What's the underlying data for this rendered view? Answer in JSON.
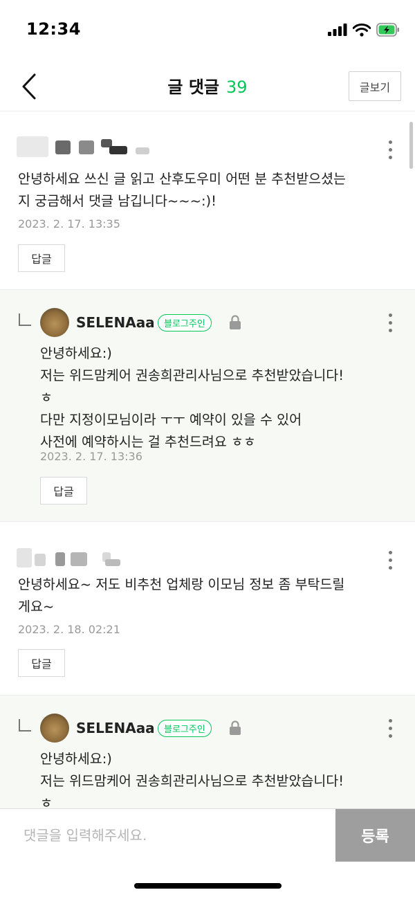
{
  "status_bar": {
    "time": "12:34"
  },
  "header": {
    "title": "글 댓글",
    "count": "39",
    "view_post_label": "글보기"
  },
  "comments": [
    {
      "text_lines": [
        "안녕하세요 쓰신 글 읽고 산후도우미 어떤 분 추천받으셨는",
        "지 궁금해서 댓글 남깁니다~~~:)!"
      ],
      "date": "2023. 2. 17. 13:35",
      "reply_label": "답글"
    },
    {
      "nickname": "SELENAaa",
      "badge": "블로그주인",
      "text_lines": [
        "안녕하세요:)",
        "저는 위드맘케어 권송희관리사님으로 추천받았습니다!",
        "ㅎ",
        "다만 지정이모님이라 ㅜㅜ 예약이 있을 수 있어",
        "사전에 예약하시는 걸 추천드려요 ㅎㅎ"
      ],
      "date": "2023. 2. 17. 13:36",
      "reply_label": "답글"
    },
    {
      "text_lines": [
        "안녕하세요~ 저도 비추천 업체랑 이모님 정보 좀 부탁드릴",
        "게요~"
      ],
      "date": "2023. 2. 18. 02:21",
      "reply_label": "답글"
    },
    {
      "nickname": "SELENAaa",
      "badge": "블로그주인",
      "text_lines": [
        "안녕하세요:)",
        "저는 위드맘케어 권송희관리사님으로 추천받았습니다!",
        "ㅎ"
      ]
    }
  ],
  "input": {
    "placeholder": "댓글을 입력해주세요.",
    "submit_label": "등록"
  },
  "colors": {
    "accent": "#03c75a",
    "reply_background": "#f7faf4",
    "submit_background": "#9e9e9e"
  },
  "icons": [
    "back-icon",
    "more-icon",
    "lock-icon",
    "reply-arrow-icon",
    "signal-icon",
    "wifi-icon",
    "battery-icon"
  ]
}
